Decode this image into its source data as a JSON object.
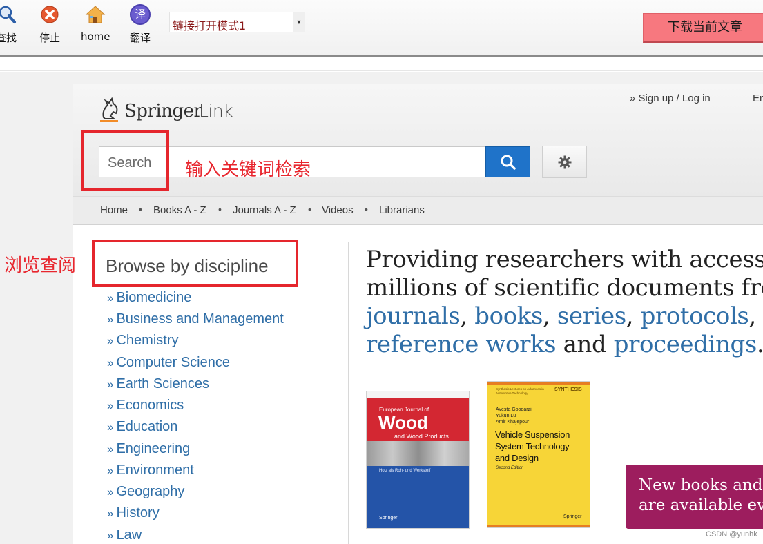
{
  "toolbar": {
    "find_label": "查找",
    "stop_label": "停止",
    "home_label": "home",
    "translate_label": "翻译",
    "translate_glyph": "译",
    "link_mode": "链接打开模式1",
    "download_label": "下载当前文章"
  },
  "site": {
    "logo_word1": "Springer",
    "logo_word2": "Link",
    "signin": "» Sign up / Log in",
    "lang": "English",
    "search_placeholder": "Search",
    "nav": [
      "Home",
      "Books A - Z",
      "Journals A - Z",
      "Videos",
      "Librarians"
    ],
    "nav_sep": "•"
  },
  "annotations": {
    "search_hint": "输入关键词检索",
    "browse_hint": "浏览查阅"
  },
  "browse": {
    "title": "Browse by discipline",
    "marker": "»",
    "items": [
      "Biomedicine",
      "Business and Management",
      "Chemistry",
      "Computer Science",
      "Earth Sciences",
      "Economics",
      "Education",
      "Engineering",
      "Environment",
      "Geography",
      "History",
      "Law"
    ]
  },
  "hero": {
    "l1": "Providing researchers with access to",
    "l2": "millions of scientific documents from",
    "journals": "journals",
    "books": "books",
    "series": "series",
    "protocols": "protocols",
    "reference_works": "reference works",
    "and": "and",
    "proceedings": "proceedings",
    "comma": ",",
    "period": "."
  },
  "books": {
    "wood": {
      "top": "European Journal of",
      "title": "Wood",
      "sub": "and Wood Products",
      "german": "Holz als Roh- und Werkstoff",
      "publisher": "Springer"
    },
    "vehicle": {
      "series": "Synthesis Lectures on Advances in Automotive Technology",
      "brand": "SYNTHESIS",
      "authors": [
        "Avesta Goodarzi",
        "Yukun Lu",
        "Amir Khajepour"
      ],
      "title": [
        "Vehicle Suspension",
        "System Technology",
        "and Design"
      ],
      "edition": "Second Edition",
      "publisher": "Springer"
    }
  },
  "promo": {
    "l1": "New books and journals",
    "l2": "are available every day."
  },
  "watermark": "CSDN @yunhk",
  "colors": {
    "accent_link": "#2f6ea7",
    "search_button": "#1f73c9",
    "annotation_red": "#e5262d",
    "download_button": "#f7787f",
    "promo": "#9d1d5e"
  }
}
